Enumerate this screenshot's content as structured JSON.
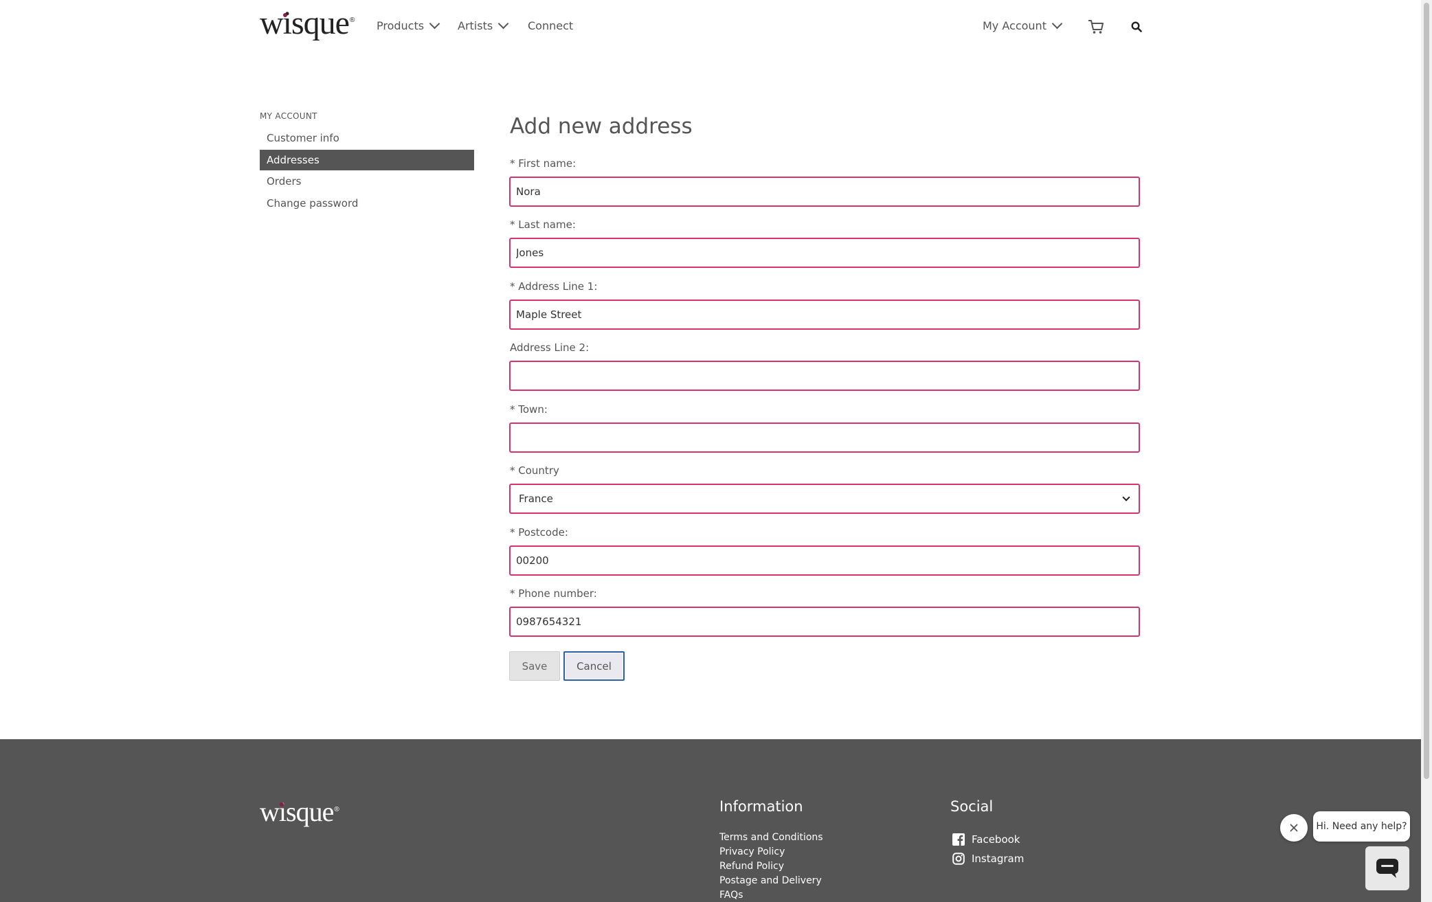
{
  "header": {
    "logo_text": "wisque",
    "nav": {
      "products": "Products",
      "artists": "Artists",
      "connect": "Connect",
      "my_account": "My Account"
    }
  },
  "sidebar": {
    "heading": "MY ACCOUNT",
    "items": [
      {
        "label": "Customer info"
      },
      {
        "label": "Addresses"
      },
      {
        "label": "Orders"
      },
      {
        "label": "Change password"
      }
    ],
    "active": "Addresses"
  },
  "form": {
    "title": "Add new address",
    "first_name": {
      "label": "* First name:",
      "value": "Nora"
    },
    "last_name": {
      "label": "* Last name:",
      "value": "Jones"
    },
    "address1": {
      "label": "* Address Line 1:",
      "value": "Maple Street"
    },
    "address2": {
      "label": "Address Line 2:",
      "value": ""
    },
    "town": {
      "label": "* Town:",
      "value": ""
    },
    "country": {
      "label": "* Country",
      "value": "France"
    },
    "postcode": {
      "label": "* Postcode:",
      "value": "00200"
    },
    "phone": {
      "label": "* Phone number:",
      "value": "0987654321"
    },
    "save_label": "Save",
    "cancel_label": "Cancel"
  },
  "footer": {
    "logo_text": "wisque",
    "information": {
      "heading": "Information",
      "links": [
        "Terms and Conditions",
        "Privacy Policy",
        "Refund Policy",
        "Postage and Delivery",
        "FAQs"
      ]
    },
    "social": {
      "heading": "Social",
      "facebook": "Facebook",
      "instagram": "Instagram"
    }
  },
  "chat": {
    "greeting": "Hi. Need any help?"
  },
  "colors": {
    "input_border": "#d6336c",
    "active_sidebar": "#555555",
    "footer_bg": "#555555",
    "logo_dot": "#8a1d4c"
  },
  "icons": [
    "chevron-down-icon",
    "cart-icon",
    "search-icon",
    "facebook-icon",
    "instagram-icon",
    "close-icon",
    "chat-icon"
  ]
}
